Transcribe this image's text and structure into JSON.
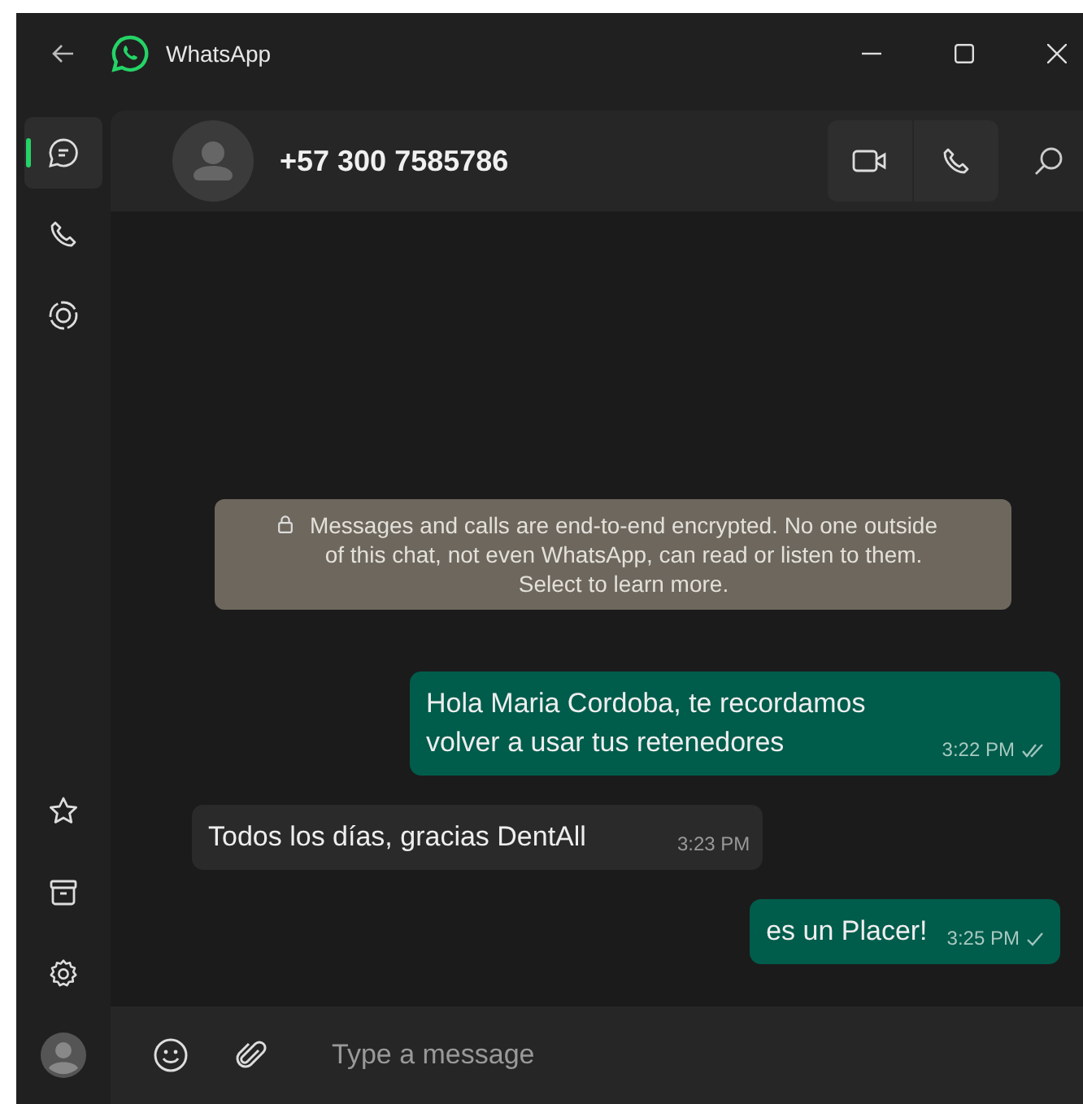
{
  "window": {
    "title": "WhatsApp"
  },
  "sidebar": {
    "top_items": [
      {
        "kind": "chats",
        "selected": true
      },
      {
        "kind": "calls",
        "selected": false
      },
      {
        "kind": "status",
        "selected": false
      }
    ],
    "bottom_items": [
      {
        "kind": "starred",
        "selected": false
      },
      {
        "kind": "archive",
        "selected": false
      },
      {
        "kind": "settings",
        "selected": false
      },
      {
        "kind": "profile",
        "selected": false
      }
    ]
  },
  "chat_header": {
    "contact": "+57 300 7585786"
  },
  "encryption_notice": "Messages and calls are end-to-end encrypted. No one outside of this chat, not even WhatsApp, can read or listen to them. Select to learn more.",
  "messages": [
    {
      "kind": "out",
      "text": "Hola Maria Cordoba, te recordamos volver a usar tus retenedores",
      "time": "3:22 PM",
      "read": true
    },
    {
      "kind": "in",
      "text": "Todos los días, gracias DentAll",
      "time": "3:23 PM"
    },
    {
      "kind": "out",
      "text": "es un Placer!",
      "time": "3:25 PM",
      "read": false
    }
  ],
  "composer": {
    "placeholder": "Type a message"
  }
}
